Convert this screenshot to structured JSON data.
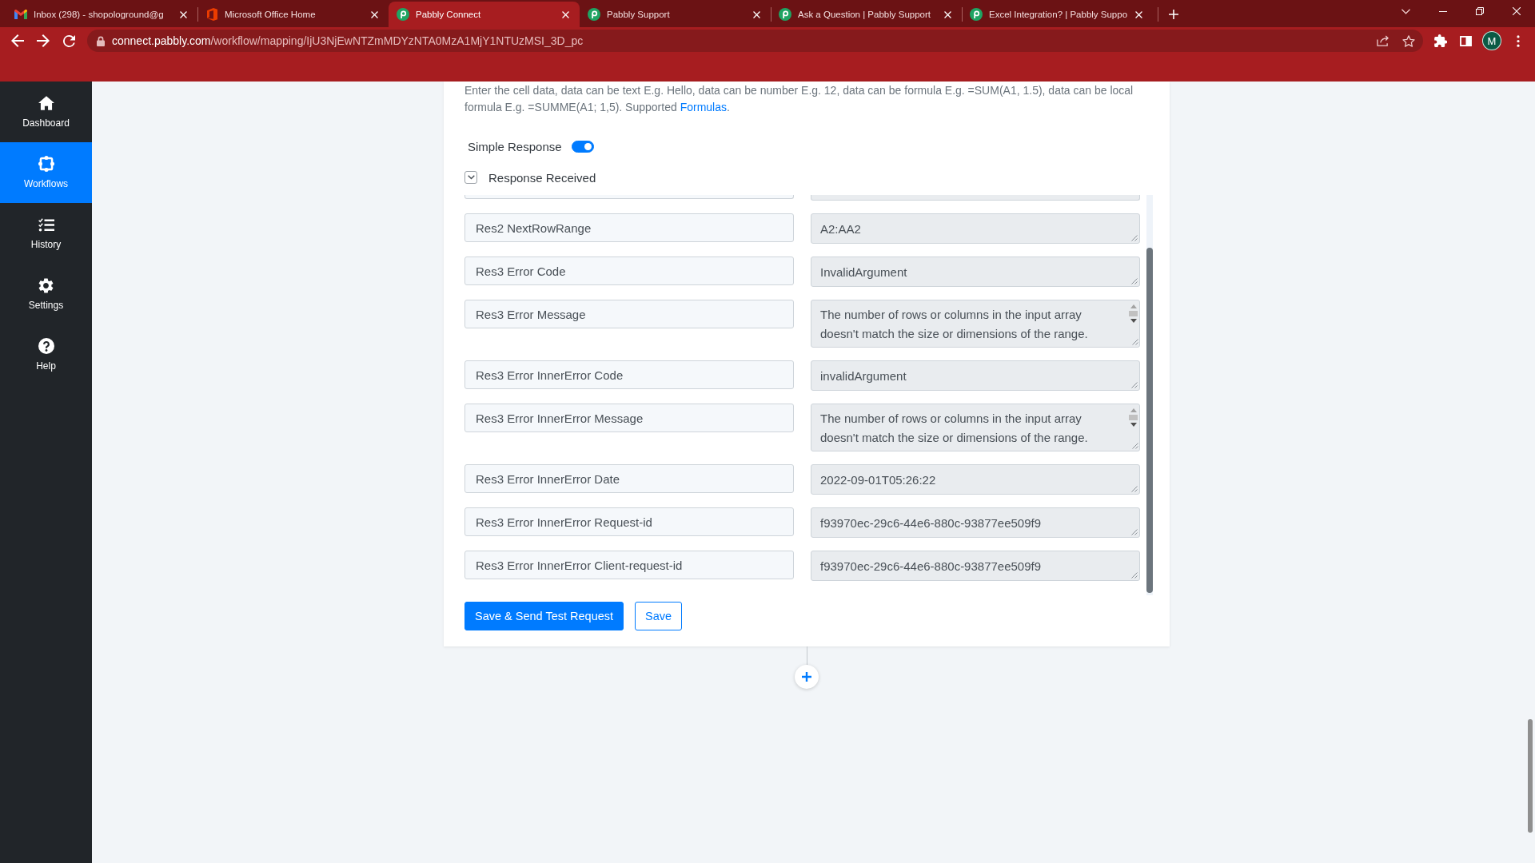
{
  "browser": {
    "tabs": [
      {
        "title": "Inbox (298) - shopologround@g",
        "kind": "mail",
        "selected": false
      },
      {
        "title": "Microsoft Office Home",
        "kind": "office",
        "selected": false
      },
      {
        "title": "Pabbly Connect",
        "kind": "pabbly",
        "selected": true
      },
      {
        "title": "Pabbly Support",
        "kind": "pabbly",
        "selected": false
      },
      {
        "title": "Ask a Question | Pabbly Support",
        "kind": "pabbly",
        "selected": false
      },
      {
        "title": "Excel Integration? | Pabbly Suppo",
        "kind": "pabbly",
        "selected": false
      }
    ],
    "url": {
      "host": "connect.pabbly.com",
      "path": "/workflow/mapping/IjU3NjEwNTZmMDYzNTA0MzA1MjY1NTUzMSI_3D_pc"
    },
    "profile_initial": "M"
  },
  "sidebar": {
    "items": [
      {
        "label": "Dashboard",
        "kind": "home",
        "selected": false
      },
      {
        "label": "Workflows",
        "kind": "workflow",
        "selected": true
      },
      {
        "label": "History",
        "kind": "history",
        "selected": false
      },
      {
        "label": "Settings",
        "kind": "settings",
        "selected": false
      },
      {
        "label": "Help",
        "kind": "help",
        "selected": false
      }
    ]
  },
  "card": {
    "hint": {
      "text": "Enter the cell data, data can be text E.g. Hello, data can be number E.g. 12, data can be formula E.g. =SUM(A1, 1.5), data can be local formula E.g. =SUMME(A1; 1,5). Supported ",
      "link": "Formulas",
      "end": "."
    },
    "simple_response": {
      "label": "Simple Response",
      "on": true
    },
    "response_received": {
      "label": "Response Received",
      "expanded": true
    },
    "rows": [
      {
        "kind": "cut"
      },
      {
        "kind": "line",
        "label": "Res2 NextRowRange",
        "value": "A2:AA2"
      },
      {
        "kind": "line",
        "label": "Res3 Error Code",
        "value": "InvalidArgument"
      },
      {
        "kind": "area",
        "label": "Res3 Error Message",
        "value": "The number of rows or columns in the input array doesn't match the size or dimensions of the range."
      },
      {
        "kind": "line",
        "label": "Res3 Error InnerError Code",
        "value": "invalidArgument"
      },
      {
        "kind": "area",
        "label": "Res3 Error InnerError Message",
        "value": "The number of rows or columns in the input array doesn't match the size or dimensions of the range."
      },
      {
        "kind": "line",
        "label": "Res3 Error InnerError Date",
        "value": "2022-09-01T05:26:22"
      },
      {
        "kind": "line",
        "label": "Res3 Error InnerError Request-id",
        "value": "f93970ec-29c6-44e6-880c-93877ee509f9"
      },
      {
        "kind": "line",
        "label": "Res3 Error InnerError Client-request-id",
        "value": "f93970ec-29c6-44e6-880c-93877ee509f9"
      }
    ],
    "buttons": [
      {
        "label": "Save & Send Test Request",
        "kind": "primary"
      },
      {
        "label": "Save",
        "kind": "outline"
      }
    ]
  }
}
